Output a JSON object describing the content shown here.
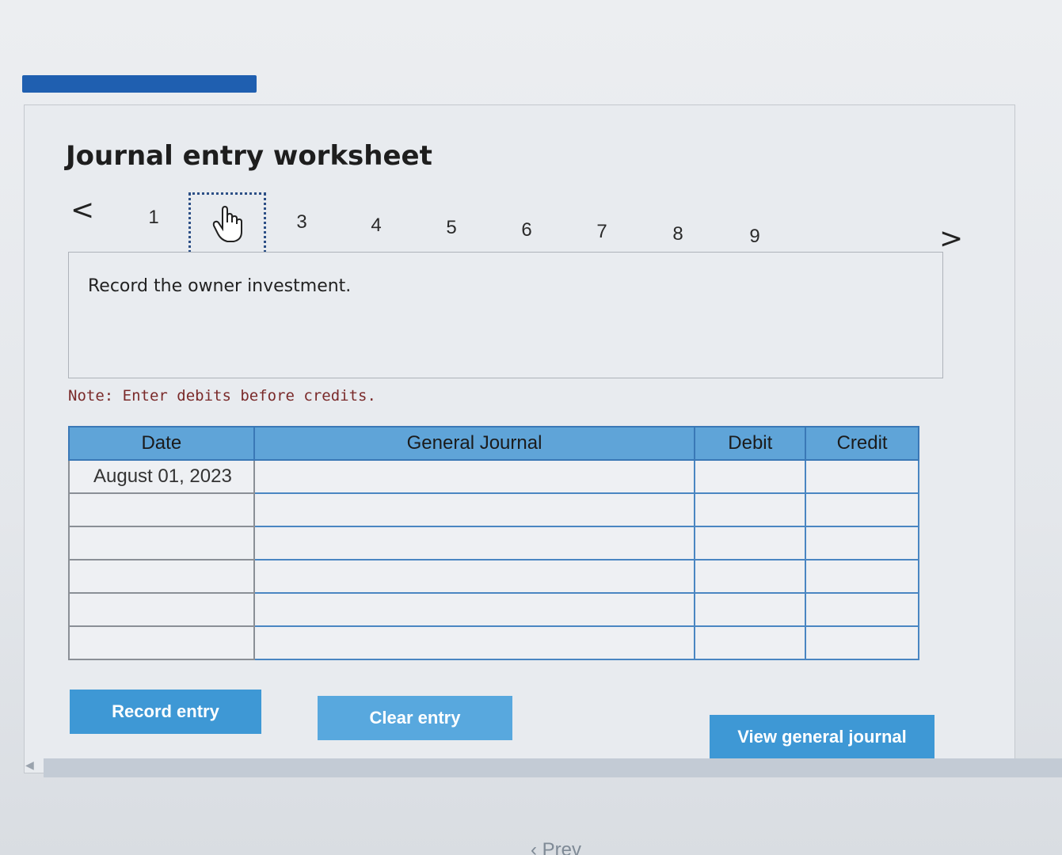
{
  "worksheet": {
    "title": "Journal entry worksheet",
    "nav": {
      "prev_glyph": "<",
      "next_glyph": ">",
      "steps": [
        "1",
        "2",
        "3",
        "4",
        "5",
        "6",
        "7",
        "8",
        "9"
      ],
      "current_step": "2"
    },
    "prompt": "Record the owner investment.",
    "note": "Note: Enter debits before credits."
  },
  "journal": {
    "headers": {
      "date": "Date",
      "general_journal": "General Journal",
      "debit": "Debit",
      "credit": "Credit"
    },
    "rows": [
      {
        "date": "August 01, 2023",
        "account": "",
        "debit": "",
        "credit": ""
      },
      {
        "date": "",
        "account": "",
        "debit": "",
        "credit": ""
      },
      {
        "date": "",
        "account": "",
        "debit": "",
        "credit": ""
      },
      {
        "date": "",
        "account": "",
        "debit": "",
        "credit": ""
      },
      {
        "date": "",
        "account": "",
        "debit": "",
        "credit": ""
      },
      {
        "date": "",
        "account": "",
        "debit": "",
        "credit": ""
      }
    ]
  },
  "buttons": {
    "record_entry": "Record entry",
    "clear_entry": "Clear entry",
    "view_general_journal": "View general journal"
  },
  "footer": {
    "prev_label": "Prev"
  },
  "colors": {
    "accent_bar": "#1f5fb0",
    "header_fill": "#5fa4d8",
    "button_fill": "#3e98d5",
    "note_text": "#7a2a2a"
  },
  "icons": {
    "current_step": "hand-pointer-icon"
  }
}
